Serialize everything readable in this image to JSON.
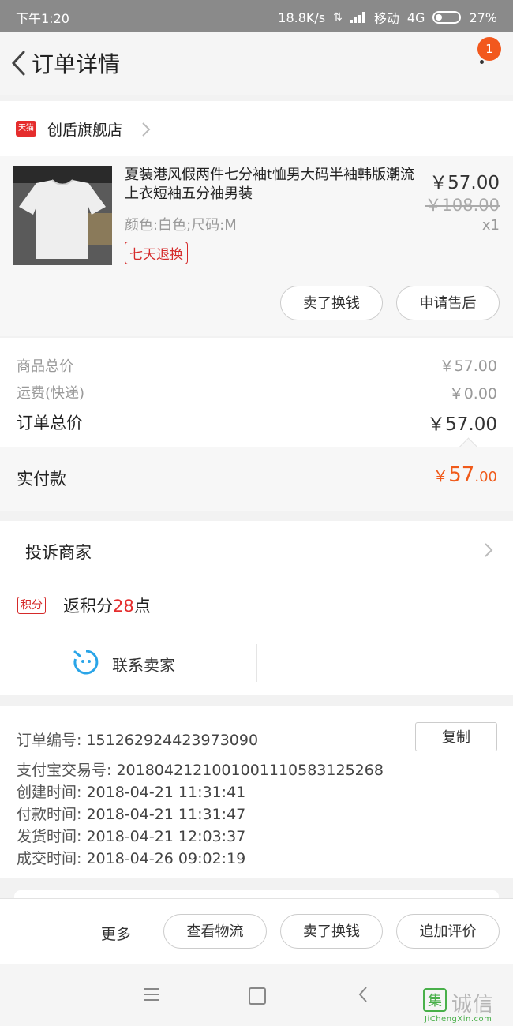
{
  "status_bar": {
    "time": "下午1:20",
    "speed": "18.8K/s",
    "carrier": "移动",
    "network": "4G",
    "battery": "27%"
  },
  "header": {
    "title": "订单详情",
    "notification_count": "1"
  },
  "shop": {
    "name": "创盾旗舰店",
    "logo_text": "天猫"
  },
  "product": {
    "title": "夏装港风假两件七分袖t恤男大码半袖韩版潮流上衣短袖五分袖男装",
    "spec": "颜色:白色;尺码:M",
    "return_tag": "七天退换",
    "price": "￥57.00",
    "original_price": "￥108.00",
    "quantity": "x1",
    "actions": [
      "卖了换钱",
      "申请售后"
    ]
  },
  "summary": {
    "goods_total_label": "商品总价",
    "goods_total_value": "￥57.00",
    "shipping_label": "运费(快递)",
    "shipping_value": "￥0.00",
    "order_total_label": "订单总价",
    "order_total_value": "￥57.00",
    "paid_label": "实付款",
    "paid_currency": "￥",
    "paid_int": "57",
    "paid_dec": ".00"
  },
  "service": {
    "complain_label": "投诉商家",
    "points_tag": "积分",
    "points_prefix": "返积分",
    "points_num": "28",
    "points_suffix": "点",
    "contact_label": "联系卖家"
  },
  "order_info": {
    "copy_label": "复制",
    "lines": [
      {
        "label": "订单编号:",
        "value": "151262924423973090"
      },
      {
        "label": "支付宝交易号:",
        "value": "2018042121001001110583125268"
      },
      {
        "label": "创建时间:",
        "value": "2018-04-21 11:31:41"
      },
      {
        "label": "付款时间:",
        "value": "2018-04-21 11:31:47"
      },
      {
        "label": "发货时间:",
        "value": "2018-04-21 12:03:37"
      },
      {
        "label": "成交时间:",
        "value": "2018-04-26 09:02:19"
      }
    ]
  },
  "action_bar": {
    "more_label": "更多",
    "buttons": [
      "查看物流",
      "卖了换钱",
      "追加评价"
    ]
  },
  "watermark": {
    "logo_char": "集",
    "text": "诚信",
    "url": "JiChengXin.com"
  },
  "colors": {
    "accent_orange": "#f05a1a",
    "tmall_red": "#e52d2d",
    "badge": "#f2581d",
    "contact_blue": "#2aa5e8"
  },
  "icons": [
    "back-icon",
    "more-vert-icon",
    "chevron-right-icon",
    "contact-seller-icon",
    "menu-icon",
    "home-icon",
    "back-nav-icon"
  ]
}
